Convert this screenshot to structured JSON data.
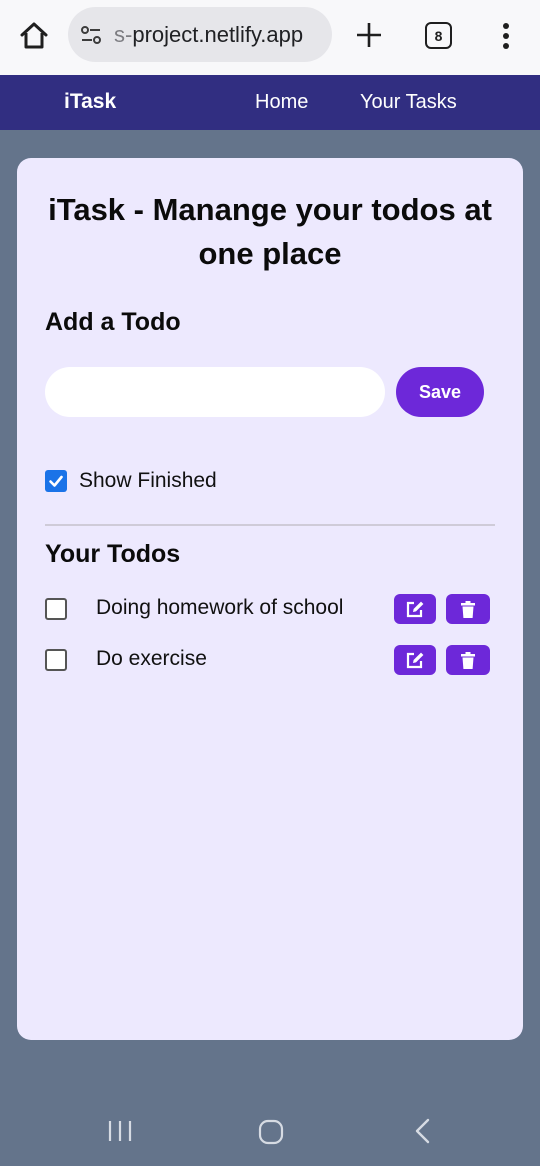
{
  "browser": {
    "url_prefix": "s-",
    "url_main": "project.netlify.app",
    "tab_count": "8",
    "icons": [
      "home-icon",
      "site-settings-icon",
      "plus-icon",
      "tabs-icon",
      "more-vert-icon"
    ]
  },
  "navbar": {
    "brand": "iTask",
    "links": [
      "Home",
      "Your Tasks"
    ],
    "color": "#312e81"
  },
  "main": {
    "title": "iTask - Manange your todos at one place",
    "add_heading": "Add a Todo",
    "input_value": "",
    "save_label": "Save",
    "show_finished_label": "Show Finished",
    "show_finished_checked": true,
    "todos_heading": "Your Todos",
    "todos": [
      {
        "text": "Doing homework of school",
        "done": false
      },
      {
        "text": "Do exercise",
        "done": false
      }
    ],
    "accent": "#6d28d9",
    "card_bg": "#ede9fe"
  },
  "system_nav": {
    "icons": [
      "recents-icon",
      "home-button-icon",
      "back-icon"
    ]
  }
}
